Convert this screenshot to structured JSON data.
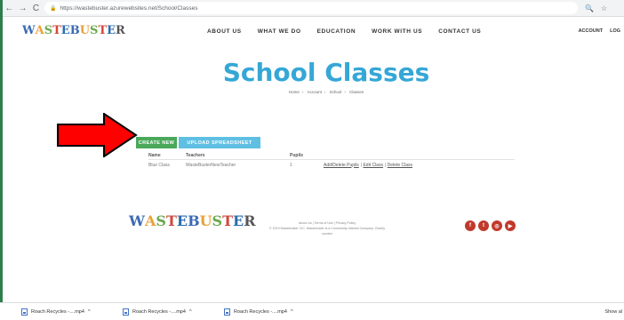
{
  "browser": {
    "url": "https://wastebuster.azurewebsites.net/School/Classes",
    "nav": {
      "back": "←",
      "forward": "→",
      "reload": "C"
    }
  },
  "header": {
    "logo": "WASTEBUSTER",
    "nav_items": [
      "ABOUT US",
      "WHAT WE DO",
      "EDUCATION",
      "WORK WITH US",
      "CONTACT US"
    ],
    "account": [
      "ACCOUNT",
      "LOG"
    ]
  },
  "page": {
    "title": "School Classes",
    "breadcrumbs": [
      "Home",
      "Account",
      "School",
      "Classes"
    ],
    "buttons": {
      "create": "CREATE NEW",
      "upload": "UPLOAD SPREADSHEET"
    }
  },
  "table": {
    "headers": [
      "Name",
      "Teachers",
      "Pupils",
      ""
    ],
    "rows": [
      {
        "name": "Blue Class",
        "teachers": "WasteBusterNewTeacher",
        "pupils": "1",
        "actions": [
          "Add/Delete Pupils",
          "Edit Class",
          "Delete Class"
        ]
      }
    ]
  },
  "footer": {
    "links": "About Us | Terms of Use | Privacy Policy",
    "copyright": "© 2019 Wastebuster CIC. Wastebuster is a Community Interest Company. Charity number",
    "social": [
      {
        "name": "facebook",
        "glyph": "f",
        "color": "#c0392b"
      },
      {
        "name": "twitter",
        "glyph": "t",
        "color": "#c0392b"
      },
      {
        "name": "instagram",
        "glyph": "◎",
        "color": "#c0392b"
      },
      {
        "name": "youtube",
        "glyph": "▶",
        "color": "#c0392b"
      }
    ]
  },
  "downloads": {
    "items": [
      "Roach Recycles -....mp4",
      "Roach Recycles -....mp4",
      "Roach Recycles -....mp4"
    ],
    "show_all": "Show al"
  },
  "annotation": {
    "arrow_color": "#ff0000"
  }
}
